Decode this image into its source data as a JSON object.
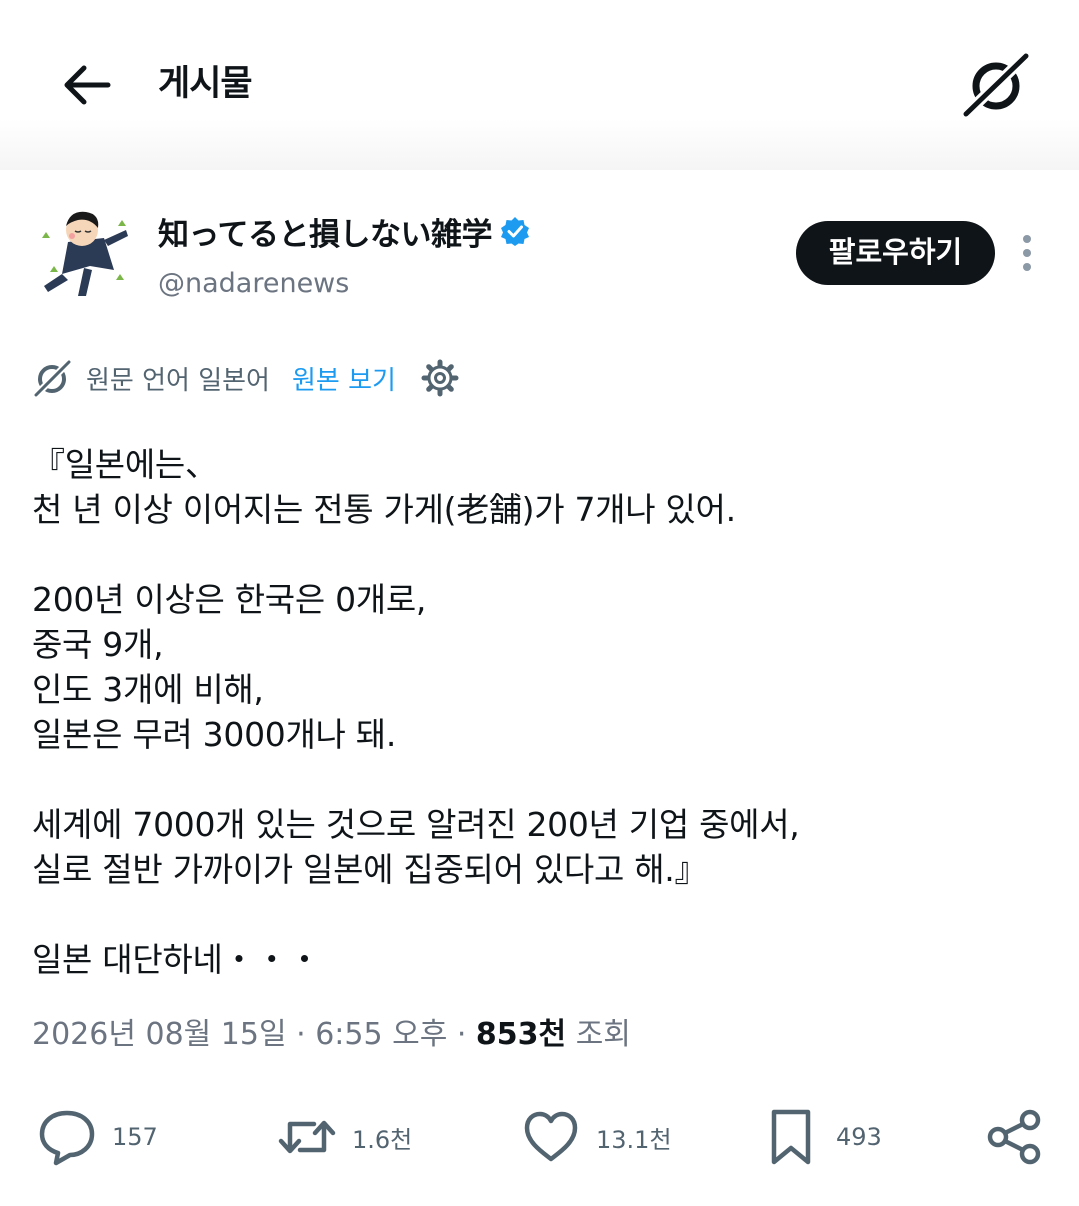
{
  "header": {
    "title": "게시물"
  },
  "author": {
    "display_name": "知ってると損しない雑学",
    "handle": "@nadarenews",
    "verified": true
  },
  "follow_label": "팔로우하기",
  "translation": {
    "notice": "원문 언어 일본어",
    "show_original": "원본 보기"
  },
  "tweet_lines": [
    "『일본에는、",
    "천 년 이상 이어지는 전통 가게(老舗)가 7개나 있어.",
    "",
    "200년 이상은 한국은 0개로,",
    "중국 9개,",
    "인도 3개에 비해,",
    "일본은 무려 3000개나 돼.",
    "",
    "세계에 7000개 있는 것으로 알려진 200년 기업 중에서,",
    "실로 절반 가까이가 일본에 집중되어 있다고 해.』",
    "",
    "일본 대단하네・・・"
  ],
  "meta": {
    "date": "2026년 08월 15일",
    "time": "6:55 오후",
    "views_count": "853천",
    "views_label": "조회"
  },
  "actions": {
    "replies": "157",
    "reposts": "1.6천",
    "likes": "13.1천",
    "bookmarks": "493"
  },
  "colors": {
    "accent": "#1d9bf0",
    "text": "#0f1419",
    "secondary": "#536471"
  },
  "icons": [
    "arrow-left-icon",
    "grok-icon",
    "verified-badge-icon",
    "more-icon",
    "translate-icon",
    "gear-icon",
    "reply-icon",
    "repost-icon",
    "like-icon",
    "bookmark-icon",
    "share-icon"
  ]
}
